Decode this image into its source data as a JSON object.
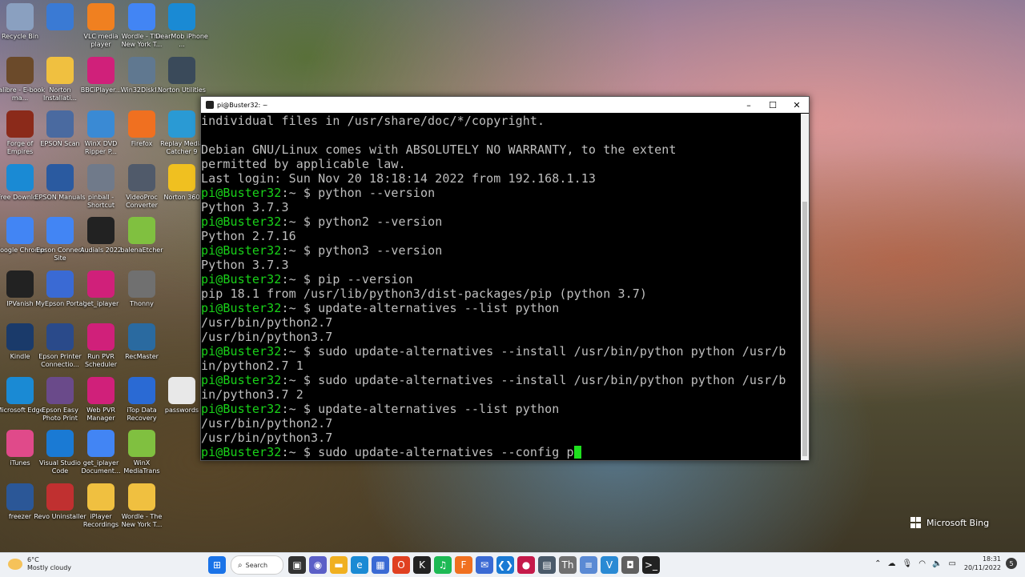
{
  "desktop_icons": [
    {
      "label": "Recycle Bin",
      "icon": "recycle-bin-icon",
      "color": "#8aa0c0"
    },
    {
      "label": "calibre - E-book ma...",
      "icon": "calibre-icon",
      "color": "#6b4a2a"
    },
    {
      "label": "Forge of Empires",
      "icon": "forge-of-empires-icon",
      "color": "#8b2a1a"
    },
    {
      "label": "Free Downlo...",
      "icon": "free-download-icon",
      "color": "#1a8ad4"
    },
    {
      "label": "Google Chrome",
      "icon": "chrome-icon",
      "color": "#4285f4"
    },
    {
      "label": "IPVanish",
      "icon": "ipvanish-icon",
      "color": "#222222"
    },
    {
      "label": "Kindle",
      "icon": "kindle-icon",
      "color": "#1a3a6a"
    },
    {
      "label": "Microsoft Edge",
      "icon": "edge-icon",
      "color": "#1a8ad4"
    },
    {
      "label": "iTunes",
      "icon": "itunes-icon",
      "color": "#e04a8a"
    },
    {
      "label": "freezer",
      "icon": "word-doc-icon",
      "color": "#2b5797"
    },
    {
      "label": "",
      "icon": "control-panel-icon",
      "color": "#3a7ad4"
    },
    {
      "label": "Norton Installati...",
      "icon": "folder-icon",
      "color": "#f0c040"
    },
    {
      "label": "EPSON Scan",
      "icon": "epson-scan-icon",
      "color": "#4a6aa0"
    },
    {
      "label": "EPSON Manuals",
      "icon": "epson-manuals-icon",
      "color": "#2a5aa0"
    },
    {
      "label": "Epson Connect Site",
      "icon": "chrome-icon",
      "color": "#4285f4"
    },
    {
      "label": "MyEpson Portal",
      "icon": "myepson-icon",
      "color": "#3a6ad4"
    },
    {
      "label": "Epson Printer Connectio...",
      "icon": "epson-printer-icon",
      "color": "#2a4a8a"
    },
    {
      "label": "Epson Easy Photo Print",
      "icon": "epson-photo-icon",
      "color": "#6a4a8a"
    },
    {
      "label": "Visual Studio Code",
      "icon": "vscode-icon",
      "color": "#1a7ad4"
    },
    {
      "label": "Revo Uninstaller",
      "icon": "revo-icon",
      "color": "#c03030"
    },
    {
      "label": "VLC media player",
      "icon": "vlc-icon",
      "color": "#f08020"
    },
    {
      "label": "BBCiPlayer...",
      "icon": "iplayer-icon",
      "color": "#d0207a"
    },
    {
      "label": "WinX DVD Ripper P...",
      "icon": "winx-dvd-icon",
      "color": "#3a8ad4"
    },
    {
      "label": "pinball - Shortcut",
      "icon": "pinball-icon",
      "color": "#707a8a"
    },
    {
      "label": "Audials 2022",
      "icon": "audials-icon",
      "color": "#222222"
    },
    {
      "label": "get_iplayer",
      "icon": "iplayer-icon",
      "color": "#d0207a"
    },
    {
      "label": "Run PVR Scheduler",
      "icon": "pvr-icon",
      "color": "#d0207a"
    },
    {
      "label": "Web PVR Manager",
      "icon": "pvr-icon",
      "color": "#d0207a"
    },
    {
      "label": "get_iplayer Document...",
      "icon": "chrome-icon",
      "color": "#4285f4"
    },
    {
      "label": "iPlayer Recordings",
      "icon": "folder-icon",
      "color": "#f0c040"
    },
    {
      "label": "Wordle - The New York T...",
      "icon": "chrome-icon",
      "color": "#4285f4"
    },
    {
      "label": "Win32DiskI...",
      "icon": "win32disk-icon",
      "color": "#607890"
    },
    {
      "label": "Firefox",
      "icon": "firefox-icon",
      "color": "#f07020"
    },
    {
      "label": "VideoProc Converter",
      "icon": "videoproc-icon",
      "color": "#505a6a"
    },
    {
      "label": "balenaEtcher",
      "icon": "balena-icon",
      "color": "#80c040"
    },
    {
      "label": "Thonny",
      "icon": "thonny-icon",
      "color": "#707070"
    },
    {
      "label": "RecMaster",
      "icon": "recmaster-icon",
      "color": "#2a6aa0"
    },
    {
      "label": "iTop Data Recovery",
      "icon": "itop-icon",
      "color": "#2a6ad4"
    },
    {
      "label": "WinX MediaTrans",
      "icon": "winx-mediatrans-icon",
      "color": "#80c040"
    },
    {
      "label": "Wordle - The New York T...",
      "icon": "folder-icon",
      "color": "#f0c040"
    },
    {
      "label": "DearMob iPhone ...",
      "icon": "dearmob-icon",
      "color": "#1a8ad4"
    },
    {
      "label": "Norton Utilities",
      "icon": "norton-utilities-icon",
      "color": "#3a4a5a"
    },
    {
      "label": "Replay Media Catcher 9",
      "icon": "replay-media-icon",
      "color": "#2a9ad4"
    },
    {
      "label": "Norton 360",
      "icon": "norton-360-icon",
      "color": "#f0c020"
    },
    {
      "label": "passwords",
      "icon": "text-file-icon",
      "color": "#e8e8e8"
    }
  ],
  "terminal": {
    "title": "pi@Buster32: ~",
    "lines": [
      {
        "prompt": "",
        "text": "individual files in /usr/share/doc/*/copyright."
      },
      {
        "prompt": "",
        "text": ""
      },
      {
        "prompt": "",
        "text": "Debian GNU/Linux comes with ABSOLUTELY NO WARRANTY, to the extent"
      },
      {
        "prompt": "",
        "text": "permitted by applicable law."
      },
      {
        "prompt": "",
        "text": "Last login: Sun Nov 20 18:18:14 2022 from 192.168.1.13"
      },
      {
        "prompt": "pi@Buster32",
        "text": "python --version"
      },
      {
        "prompt": "",
        "text": "Python 3.7.3"
      },
      {
        "prompt": "pi@Buster32",
        "text": "python2 --version"
      },
      {
        "prompt": "",
        "text": "Python 2.7.16"
      },
      {
        "prompt": "pi@Buster32",
        "text": "python3 --version"
      },
      {
        "prompt": "",
        "text": "Python 3.7.3"
      },
      {
        "prompt": "pi@Buster32",
        "text": "pip --version"
      },
      {
        "prompt": "",
        "text": "pip 18.1 from /usr/lib/python3/dist-packages/pip (python 3.7)"
      },
      {
        "prompt": "pi@Buster32",
        "text": "update-alternatives --list python"
      },
      {
        "prompt": "",
        "text": "/usr/bin/python2.7"
      },
      {
        "prompt": "",
        "text": "/usr/bin/python3.7"
      },
      {
        "prompt": "pi@Buster32",
        "text": "sudo update-alternatives --install /usr/bin/python python /usr/b"
      },
      {
        "prompt": "",
        "text": "in/python2.7 1"
      },
      {
        "prompt": "pi@Buster32",
        "text": "sudo update-alternatives --install /usr/bin/python python /usr/b"
      },
      {
        "prompt": "",
        "text": "in/python3.7 2"
      },
      {
        "prompt": "pi@Buster32",
        "text": "update-alternatives --list python"
      },
      {
        "prompt": "",
        "text": "/usr/bin/python2.7"
      },
      {
        "prompt": "",
        "text": "/usr/bin/python3.7"
      },
      {
        "prompt": "pi@Buster32",
        "text": "sudo update-alternatives --config p",
        "cursor": true
      }
    ],
    "prompt_suffix": ":~ $ ",
    "controls": {
      "minimize": "–",
      "maximize": "☐",
      "close": "✕"
    }
  },
  "watermark": {
    "text": "Microsoft Bing"
  },
  "taskbar": {
    "weather_temp": "6°C",
    "weather_desc": "Mostly cloudy",
    "search_label": "Search",
    "apps": [
      {
        "icon": "windows-start-icon",
        "color": "#1a73e8",
        "glyph": "⊞"
      },
      {
        "icon": "task-view-icon",
        "color": "#333333",
        "glyph": "▣"
      },
      {
        "icon": "teams-chat-icon",
        "color": "#5b5fc7",
        "glyph": "◉"
      },
      {
        "icon": "file-explorer-icon",
        "color": "#f0b020",
        "glyph": "▬"
      },
      {
        "icon": "edge-icon",
        "color": "#1a8ad4",
        "glyph": "e"
      },
      {
        "icon": "store-icon",
        "color": "#3a6ad4",
        "glyph": "▦"
      },
      {
        "icon": "office-icon",
        "color": "#e04020",
        "glyph": "O"
      },
      {
        "icon": "kodi-icon",
        "color": "#222222",
        "glyph": "K"
      },
      {
        "icon": "spotify-icon",
        "color": "#1db954",
        "glyph": "♫"
      },
      {
        "icon": "firefox-icon",
        "color": "#f07020",
        "glyph": "F"
      },
      {
        "icon": "thunderbird-icon",
        "color": "#3a6ad4",
        "glyph": "✉"
      },
      {
        "icon": "vscode-icon",
        "color": "#1a7ad4",
        "glyph": "❮❯"
      },
      {
        "icon": "raspberry-pi-icon",
        "color": "#c51a4a",
        "glyph": "●"
      },
      {
        "icon": "putty-icon",
        "color": "#4a5a6a",
        "glyph": "▤"
      },
      {
        "icon": "thonny-icon",
        "color": "#707070",
        "glyph": "Th"
      },
      {
        "icon": "notepad-icon",
        "color": "#5a8ad4",
        "glyph": "≡"
      },
      {
        "icon": "vnc-icon",
        "color": "#2a8ad4",
        "glyph": "V"
      },
      {
        "icon": "camera-icon",
        "color": "#606060",
        "glyph": "◘"
      },
      {
        "icon": "terminal-icon",
        "color": "#222222",
        "glyph": ">_"
      }
    ],
    "time": "18:31",
    "date": "20/11/2022",
    "notification_count": "5"
  }
}
